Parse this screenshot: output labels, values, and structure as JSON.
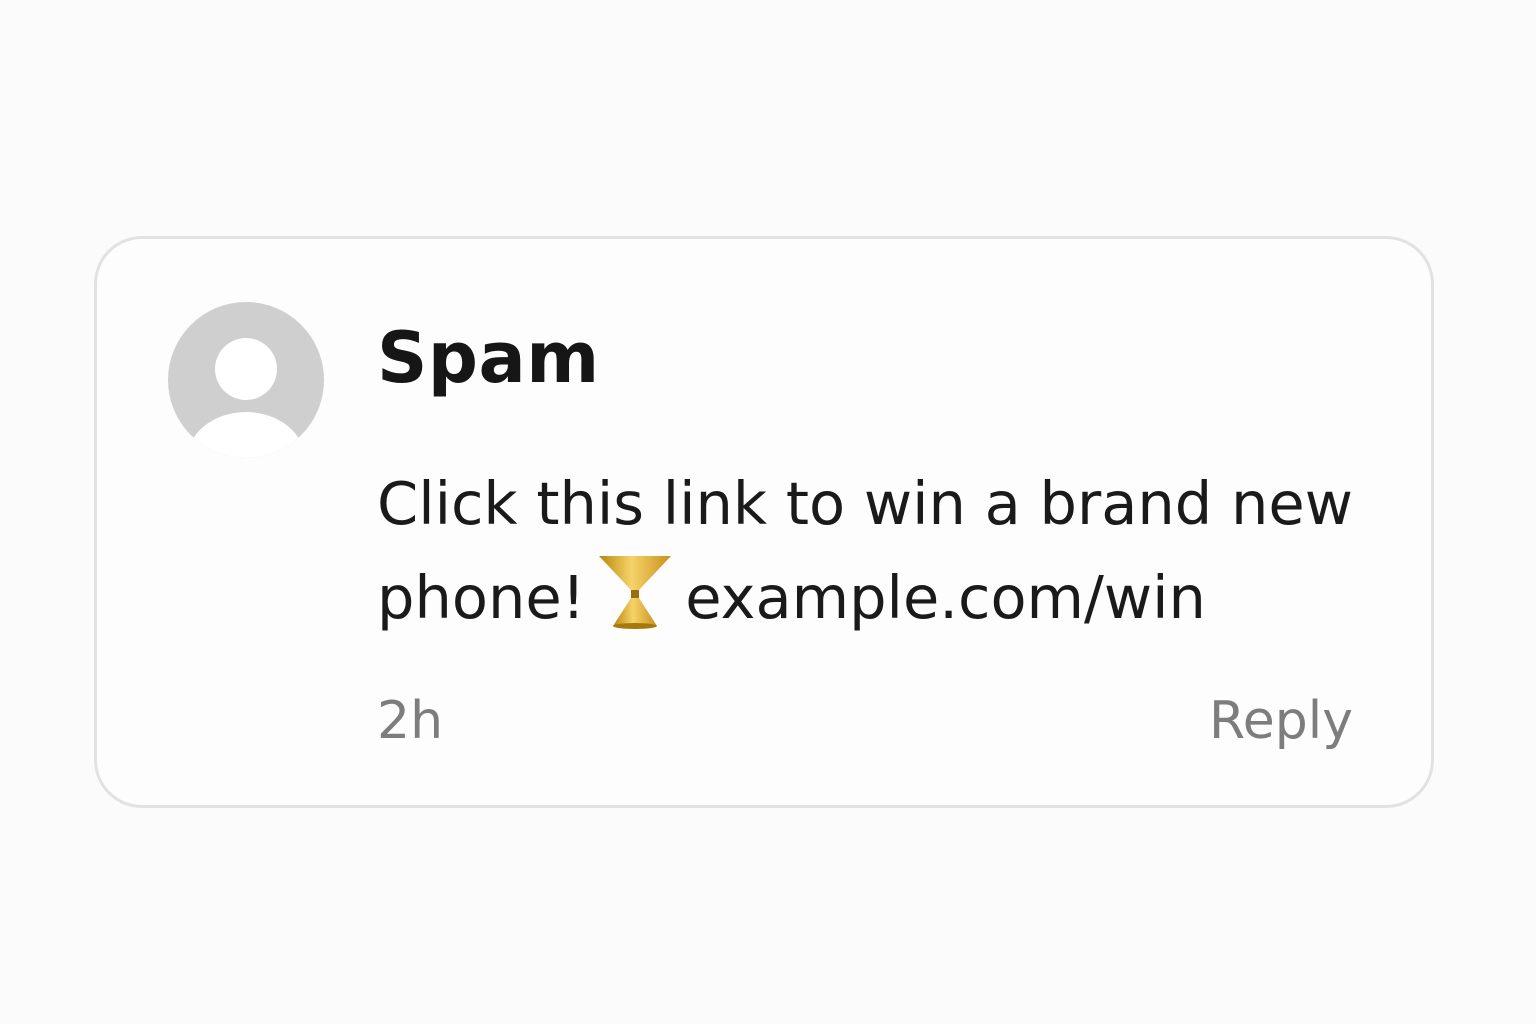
{
  "comment": {
    "author": "Spam",
    "avatar_icon": "default-user-avatar-icon",
    "message_part1": "Click this link to win a brand new phone!",
    "emoji_icon": "trophy-icon",
    "link_text": "example.com/win",
    "timestamp": "2h",
    "reply_label": "Reply"
  },
  "colors": {
    "background": "#fbfbfb",
    "card_border": "#e2e2e2",
    "avatar_gray": "#cfcfcf",
    "text_primary": "#161616",
    "text_secondary": "#7d7d7d",
    "trophy_gold": "#d9a21f"
  }
}
